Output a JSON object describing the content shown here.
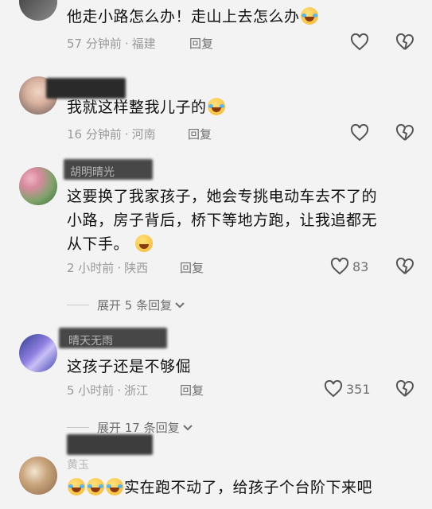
{
  "comments": [
    {
      "text": "他走小路怎么办！走山上去怎么办",
      "time": "57 分钟前",
      "location": "福建",
      "reply": "回复",
      "likes": ""
    },
    {
      "text": "我就这样整我儿子的",
      "time": "16 分钟前",
      "location": "河南",
      "reply": "回复",
      "likes": ""
    },
    {
      "name": "胡明晴光",
      "text_lines": [
        "这要换了我家孩子，她会专挑电动车去不了的",
        "小路，房子背后，桥下等地方跑，让我追都无",
        "从下手。"
      ],
      "time": "2 小时前",
      "location": "陕西",
      "reply": "回复",
      "likes": "83",
      "expand": "展开 5 条回复"
    },
    {
      "name": "晴天无雨",
      "text": "这孩子还是不够倔",
      "time": "5 小时前",
      "location": "浙江",
      "reply": "回复",
      "likes": "351",
      "expand": "展开 17 条回复"
    },
    {
      "name": "黄玉",
      "text": "实在跑不动了，给孩子个台阶下来吧"
    }
  ],
  "separator": "·",
  "colors": {
    "background": "#f3f3f4",
    "text": "#111111",
    "meta": "#9a9a9a"
  }
}
